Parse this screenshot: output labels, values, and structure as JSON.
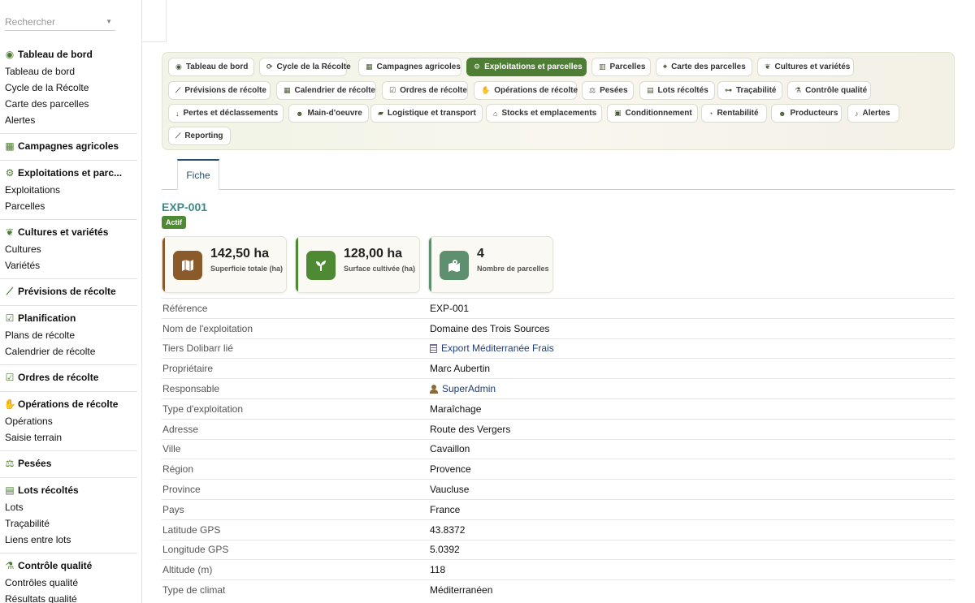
{
  "search": {
    "placeholder": "Rechercher"
  },
  "sidebar": {
    "groups": [
      {
        "title": "Tableau de bord",
        "icon": "dashboard-icon",
        "items": [
          "Tableau de bord",
          "Cycle de la Récolte",
          "Carte des parcelles",
          "Alertes"
        ]
      },
      {
        "title": "Campagnes agricoles",
        "icon": "calendar-icon",
        "items": []
      },
      {
        "title": "Exploitations et parc...",
        "icon": "tractor-icon",
        "items": [
          "Exploitations",
          "Parcelles"
        ]
      },
      {
        "title": "Cultures et variétés",
        "icon": "seedling-icon",
        "items": [
          "Cultures",
          "Variétés"
        ]
      },
      {
        "title": "Prévisions de récolte",
        "icon": "chart-line-icon",
        "items": []
      },
      {
        "title": "Planification",
        "icon": "clipboard-check-icon",
        "items": [
          "Plans de récolte",
          "Calendrier de récolte"
        ]
      },
      {
        "title": "Ordres de récolte",
        "icon": "clipboard-check-icon",
        "items": []
      },
      {
        "title": "Opérations de récolte",
        "icon": "hand-icon",
        "items": [
          "Opérations",
          "Saisie terrain"
        ]
      },
      {
        "title": "Pesées",
        "icon": "scale-icon",
        "items": []
      },
      {
        "title": "Lots récoltés",
        "icon": "boxes-icon",
        "items": [
          "Lots",
          "Traçabilité",
          "Liens entre lots"
        ]
      },
      {
        "title": "Contrôle qualité",
        "icon": "microscope-icon",
        "items": [
          "Contrôles qualité",
          "Résultats qualité"
        ]
      }
    ]
  },
  "tabs": [
    {
      "label": "Tableau de bord",
      "icon": "dashboard-icon"
    },
    {
      "label": "Cycle de la Récolte",
      "icon": "sync-icon"
    },
    {
      "label": "Campagnes agricoles",
      "icon": "calendar-icon"
    },
    {
      "label": "Exploitations et parcelles",
      "icon": "tractor-icon",
      "active": true
    },
    {
      "label": "Parcelles",
      "icon": "map-icon"
    },
    {
      "label": "Carte des parcelles",
      "icon": "map-marked-icon"
    },
    {
      "label": "Cultures et variétés",
      "icon": "seedling-icon"
    },
    {
      "label": "Prévisions de récolte",
      "icon": "chart-line-icon"
    },
    {
      "label": "Calendrier de récolte",
      "icon": "calendar-check-icon"
    },
    {
      "label": "Ordres de récolte",
      "icon": "clipboard-icon"
    },
    {
      "label": "Opérations de récolte",
      "icon": "hand-icon"
    },
    {
      "label": "Pesées",
      "icon": "scale-icon"
    },
    {
      "label": "Lots récoltés",
      "icon": "boxes-icon"
    },
    {
      "label": "Traçabilité",
      "icon": "sitemap-icon"
    },
    {
      "label": "Contrôle qualité",
      "icon": "microscope-icon"
    },
    {
      "label": "Pertes et déclassements",
      "icon": "arrow-down-icon"
    },
    {
      "label": "Main-d'oeuvre",
      "icon": "users-icon"
    },
    {
      "label": "Logistique et transport",
      "icon": "truck-icon"
    },
    {
      "label": "Stocks et emplacements",
      "icon": "warehouse-icon"
    },
    {
      "label": "Conditionnement",
      "icon": "cubes-icon"
    },
    {
      "label": "Rentabilité",
      "icon": "pie-chart-icon"
    },
    {
      "label": "Producteurs",
      "icon": "user-group-icon"
    },
    {
      "label": "Alertes",
      "icon": "bell-icon"
    },
    {
      "label": "Reporting",
      "icon": "chart-area-icon"
    }
  ],
  "subtab": {
    "label": "Fiche"
  },
  "record": {
    "ref": "EXP-001",
    "status": "Actif"
  },
  "kpis": [
    {
      "value": "142,50 ha",
      "label": "Superficie totale (ha)",
      "icon": "map-icon",
      "color": "#8b5a2b"
    },
    {
      "value": "128,00 ha",
      "label": "Surface cultivée (ha)",
      "icon": "seedling-icon",
      "color": "#4e8a34"
    },
    {
      "value": "4",
      "label": "Nombre de parcelles",
      "icon": "map-marked-icon",
      "color": "#5e8f6e"
    }
  ],
  "fields": [
    {
      "key": "Référence",
      "value": "EXP-001"
    },
    {
      "key": "Nom de l'exploitation",
      "value": "Domaine des Trois Sources"
    },
    {
      "key": "Tiers Dolibarr lié",
      "value": "Export Méditerranée Frais",
      "link": true,
      "icon": "building-icon"
    },
    {
      "key": "Propriétaire",
      "value": "Marc Aubertin"
    },
    {
      "key": "Responsable",
      "value": "SuperAdmin",
      "link": true,
      "icon": "user-icon"
    },
    {
      "key": "Type d'exploitation",
      "value": "Maraîchage"
    },
    {
      "key": "Adresse",
      "value": "Route des Vergers"
    },
    {
      "key": "Ville",
      "value": "Cavaillon"
    },
    {
      "key": "Région",
      "value": "Provence"
    },
    {
      "key": "Province",
      "value": "Vaucluse"
    },
    {
      "key": "Pays",
      "value": "France"
    },
    {
      "key": "Latitude GPS",
      "value": "43.8372"
    },
    {
      "key": "Longitude GPS",
      "value": "5.0392"
    },
    {
      "key": "Altitude (m)",
      "value": "118"
    },
    {
      "key": "Type de climat",
      "value": "Méditerranéen"
    }
  ]
}
